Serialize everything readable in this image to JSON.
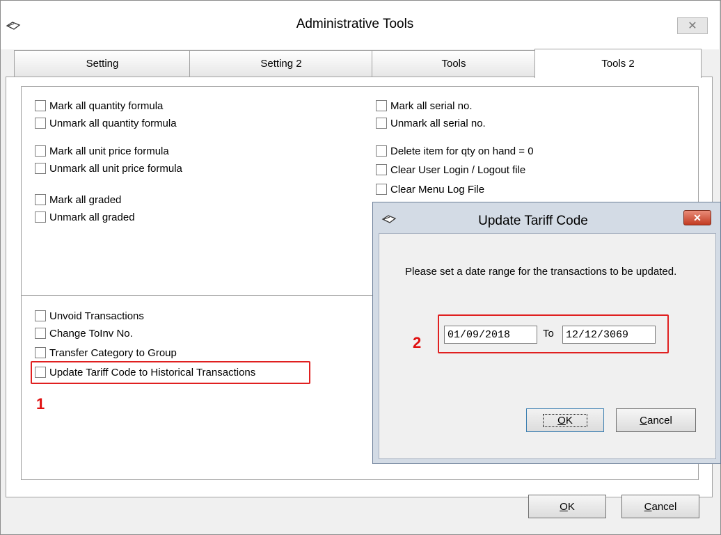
{
  "window": {
    "title": "Administrative Tools",
    "close_glyph": "✕"
  },
  "tabs": [
    {
      "label": "Setting"
    },
    {
      "label": "Setting 2"
    },
    {
      "label": "Tools"
    },
    {
      "label": "Tools 2",
      "active": true
    }
  ],
  "left_column": [
    "Mark all quantity formula",
    "Unmark all quantity formula",
    "Mark all unit price formula",
    "Unmark all unit price formula",
    "Mark all graded",
    "Unmark all graded"
  ],
  "right_column": [
    "Mark all serial no.",
    "Unmark all serial no.",
    "Delete item for qty on hand = 0",
    "Clear User Login / Logout file",
    "Clear Menu Log File"
  ],
  "bottom_group": [
    "Unvoid Transactions",
    "Change ToInv No.",
    "Transfer Category to Group",
    "Update Tariff Code to Historical Transactions"
  ],
  "annotations": {
    "marker_1": "1",
    "marker_2": "2",
    "highlight_color": "#e02020"
  },
  "footer": {
    "ok_label": "OK",
    "ok_mnemonic": "O",
    "ok_rest": "K",
    "cancel_label": "Cancel",
    "cancel_mnemonic": "C",
    "cancel_rest": "ancel"
  },
  "dialog": {
    "title": "Update Tariff Code",
    "close_glyph": "✕",
    "message": "Please set a date range for the transactions to be updated.",
    "from_date": "01/09/2018",
    "to_label": "To",
    "to_date": "12/12/3069",
    "ok_mnemonic": "O",
    "ok_rest": "K",
    "cancel_mnemonic": "C",
    "cancel_rest": "ancel"
  }
}
